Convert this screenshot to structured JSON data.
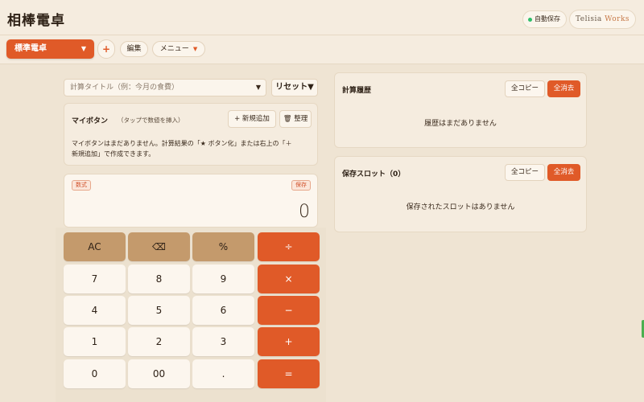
{
  "header": {
    "title": "相棒電卓",
    "autosave_label": "自動保存",
    "brand_name": "Telisia",
    "brand_accent": "Works"
  },
  "toolbar": {
    "mode_select": "標準電卓",
    "add_mode_label": "+",
    "edit_label": "編集",
    "menu_label": "メニュー"
  },
  "calc_title": {
    "placeholder": "計算タイトル（例：今月の食費）",
    "reset_label": "リセット▼"
  },
  "my_buttons": {
    "title": "マイボタン",
    "hint": "（タップで数値を挿入）",
    "add_label": "+ 新規追加",
    "organize_label": "🗑 整理",
    "empty_line1": "マイボタンはまだありません。計算結果の「★ ボタン化」または右上の「＋",
    "empty_line2": "新規追加」で作成できます。"
  },
  "display": {
    "formula_tag": "数式",
    "save_tag": "保存",
    "value": "0"
  },
  "keypad": {
    "rows": [
      [
        "AC",
        "⌫",
        "%",
        "÷"
      ],
      [
        "7",
        "8",
        "9",
        "×"
      ],
      [
        "4",
        "5",
        "6",
        "−"
      ],
      [
        "1",
        "2",
        "3",
        "+"
      ],
      [
        "0",
        "00",
        ".",
        "="
      ]
    ]
  },
  "history": {
    "title": "計算履歴",
    "copy_all": "全コピー",
    "clear_all": "全消去",
    "empty": "履歴はまだありません"
  },
  "slots": {
    "title": "保存スロット（0）",
    "copy_all": "全コピー",
    "clear_all": "全消去",
    "empty": "保存されたスロットはありません"
  },
  "colors": {
    "accent": "#e05a28",
    "function_key": "#c49a6c",
    "background": "#efe4d3",
    "autosave_dot": "#2fbf6a"
  }
}
